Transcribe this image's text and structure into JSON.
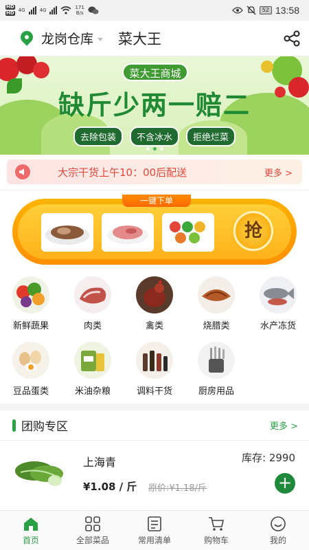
{
  "status_bar": {
    "net_speed": "171",
    "net_unit": "B/s",
    "battery": "52",
    "time": "13:58"
  },
  "header": {
    "location": "龙岗仓库",
    "store_name": "菜大王"
  },
  "banner": {
    "badge": "菜大王商城",
    "slogan": "缺斤少两一赔二",
    "tags": [
      "去除包装",
      "不含冰水",
      "拒绝烂菜"
    ]
  },
  "notice": {
    "text": "大宗干货上午10：00后配送",
    "more": "更多 >"
  },
  "promo": {
    "title": "一键下单",
    "button": "抢"
  },
  "categories": [
    {
      "label": "新鲜蔬果",
      "color": "#5a8a2c"
    },
    {
      "label": "肉类",
      "color": "#c0524a"
    },
    {
      "label": "禽类",
      "color": "#8a2a1e"
    },
    {
      "label": "烧腊类",
      "color": "#b45a28"
    },
    {
      "label": "水产冻货",
      "color": "#8a8a92"
    },
    {
      "label": "豆品蛋类",
      "color": "#d9a05b"
    },
    {
      "label": "米油杂粮",
      "color": "#7aa83a"
    },
    {
      "label": "调料干货",
      "color": "#5a3a2a"
    },
    {
      "label": "厨房用品",
      "color": "#777777"
    }
  ],
  "group_buy": {
    "title": "团购专区",
    "more": "更多 >",
    "product": {
      "name": "上海青",
      "price": "¥1.08 / 斤",
      "original_price": "原价:¥1.18/斤",
      "stock": "库存:  2990"
    }
  },
  "tabs": [
    {
      "label": "首页",
      "active": true
    },
    {
      "label": "全部菜品",
      "active": false
    },
    {
      "label": "常用清单",
      "active": false
    },
    {
      "label": "购物车",
      "active": false
    },
    {
      "label": "我的",
      "active": false
    }
  ],
  "colors": {
    "brand_green": "#2aa145",
    "notice_red": "#e3473a",
    "promo_orange": "#ff9f00"
  }
}
